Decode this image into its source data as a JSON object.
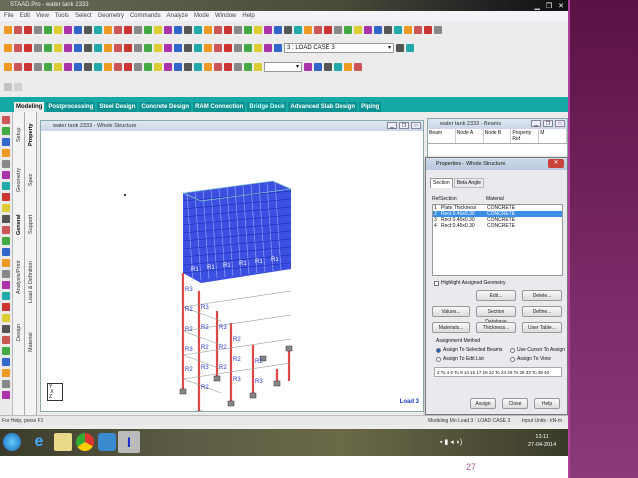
{
  "window": {
    "title": "STAAD.Pro - water tank 2333",
    "min": "▁",
    "max": "❐",
    "close": "✕"
  },
  "menu": [
    "File",
    "Edit",
    "View",
    "Tools",
    "Select",
    "Geometry",
    "Commands",
    "Analyze",
    "Mode",
    "Window",
    "Help"
  ],
  "toolbar": {
    "load_case": "3 : LOAD CASE 3"
  },
  "tabs": [
    {
      "label": "Modeling",
      "state": "active"
    },
    {
      "label": "Postprocessing"
    },
    {
      "label": "Steel Design"
    },
    {
      "label": "Concrete Design"
    },
    {
      "label": "RAM Connection"
    },
    {
      "label": "Bridge Deck",
      "state": "lite"
    },
    {
      "label": "Advanced Slab Design"
    },
    {
      "label": "Piping"
    }
  ],
  "vertical_tabs_outer": [
    "Setup",
    "Geometry",
    "General",
    "Analysis/Print",
    "Design"
  ],
  "vertical_tabs_inner": [
    "Property",
    "Spec",
    "Support",
    "Load & Definition",
    "Material"
  ],
  "main_window": {
    "title": "water tank 2333 - Whole Structure",
    "load_label": "Load 3",
    "axis": {
      "y": "Y",
      "x": "X",
      "z": "Z"
    }
  },
  "model_labels": [
    "R1",
    "R2",
    "R3"
  ],
  "beams_window": {
    "title": "water tank 2333 - Beams",
    "columns": [
      "Beam",
      "Node A",
      "Node B",
      "Property Ref",
      "M"
    ]
  },
  "properties": {
    "title": "Properties - Whole Structure",
    "tabs": [
      "Section",
      "Beta Angle"
    ],
    "headers": {
      "ref": "Ref",
      "section": "Section",
      "material": "Material"
    },
    "rows": [
      {
        "ref": "1",
        "section": "Plate Thickness",
        "material": "CONCRETE",
        "selected": false
      },
      {
        "ref": "2",
        "section": "Rect 0.40x0.30",
        "material": "CONCRETE",
        "selected": true
      },
      {
        "ref": "3",
        "section": "Rect 0.40x0.30",
        "material": "CONCRETE",
        "selected": false
      },
      {
        "ref": "4",
        "section": "Rect 0.45x0.30",
        "material": "CONCRETE",
        "selected": false
      }
    ],
    "highlight_label": "Highlight Assigned Geometry",
    "buttons": {
      "edit": "Edit...",
      "delete": "Delete...",
      "values": "Values...",
      "section_db": "Section Database",
      "define": "Define...",
      "materials": "Materials...",
      "thickness": "Thickness...",
      "user_table": "User Table...",
      "assign": "Assign",
      "close": "Close",
      "help": "Help"
    },
    "assignment_method": "Assignment Method",
    "radios": {
      "selected_beams": "Assign To Selected Beams",
      "cursor": "Use Cursor To Assign",
      "edit_list": "Assign To Edit List",
      "view": "Assign To View"
    },
    "edit_list": "2 To 4 6 To 8 14 15 17 18 22 To 24 26 To 28 33 To 38 40"
  },
  "status": {
    "help": "For Help, press F1",
    "mode": "Modeling Mo  Load 3 : LOAD CASE 3",
    "units": "Input Units : kN-m"
  },
  "clock": {
    "time": "13:11",
    "date": "27-04-2014"
  },
  "slide": {
    "page_number": "27"
  }
}
